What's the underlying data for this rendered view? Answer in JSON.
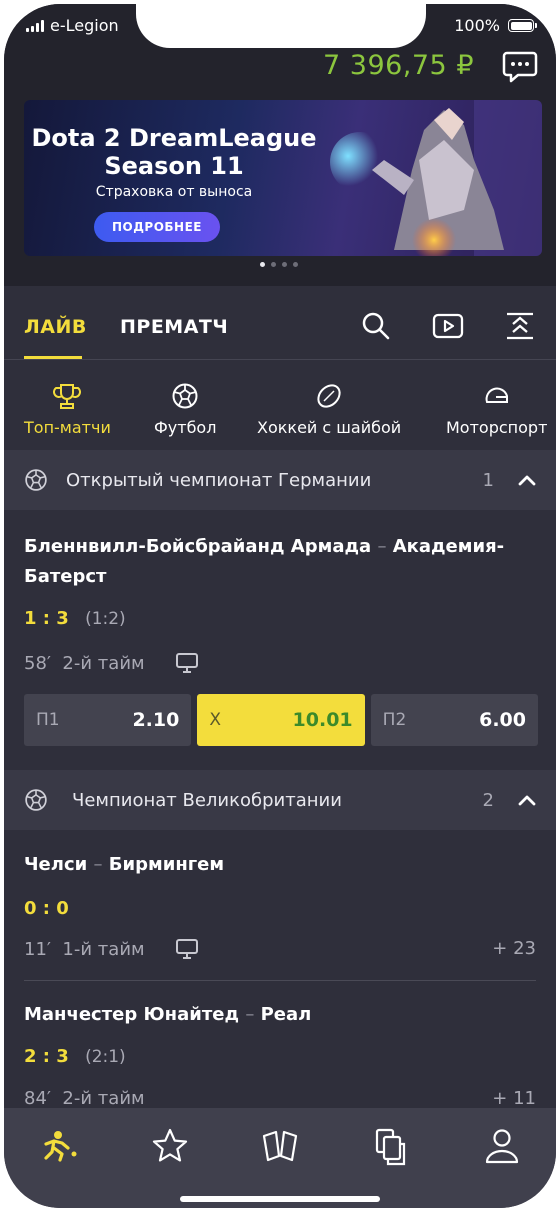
{
  "status": {
    "carrier": "e-Legion",
    "battery": "100%"
  },
  "header": {
    "balance": "7 396,75 ₽"
  },
  "banner": {
    "title_line1": "Dota 2 DreamLeague",
    "title_line2": "Season 11",
    "subtitle": "Страховка от выноса",
    "button": "ПОДРОБНЕЕ"
  },
  "tabs": {
    "live": "ЛАЙВ",
    "prematch": "ПРЕМАТЧ"
  },
  "sports": [
    {
      "label": "Топ-матчи",
      "icon": "trophy-icon"
    },
    {
      "label": "Футбол",
      "icon": "soccer-ball-icon"
    },
    {
      "label": "Хоккей с шайбой",
      "icon": "hockey-puck-icon"
    },
    {
      "label": "Моторспорт",
      "icon": "helmet-icon"
    }
  ],
  "leagues": [
    {
      "name": "Открытый чемпионат Германии",
      "count": "1",
      "matches": [
        {
          "team1": "Бленнвилл-Бойсбрайанд Армада",
          "separator": "–",
          "team2_line1": "Академия-",
          "team2_line2": "Батерст",
          "score": "1 : 3",
          "half_score": "(1:2)",
          "time": "58′  2-й тайм",
          "odds": [
            {
              "label": "П1",
              "value": "2.10"
            },
            {
              "label": "Х",
              "value": "10.01"
            },
            {
              "label": "П2",
              "value": "6.00"
            }
          ]
        }
      ]
    },
    {
      "name": "Чемпионат Великобритании",
      "count": "2",
      "matches": [
        {
          "team1": "Челси",
          "separator": "–",
          "team2": "Бирмингем",
          "score": "0 : 0",
          "time": "11′  1-й тайм",
          "more": "+ 23"
        },
        {
          "team1": "Манчестер Юнайтед",
          "separator": "–",
          "team2": "Реал",
          "score": "2 : 3",
          "half_score": "(2:1)",
          "time": "84′  2-й тайм",
          "more": "+ 11"
        }
      ]
    }
  ],
  "colors": {
    "accent": "#f3dd3c",
    "balance": "#8cc63e",
    "background": "#2f2f3b"
  }
}
